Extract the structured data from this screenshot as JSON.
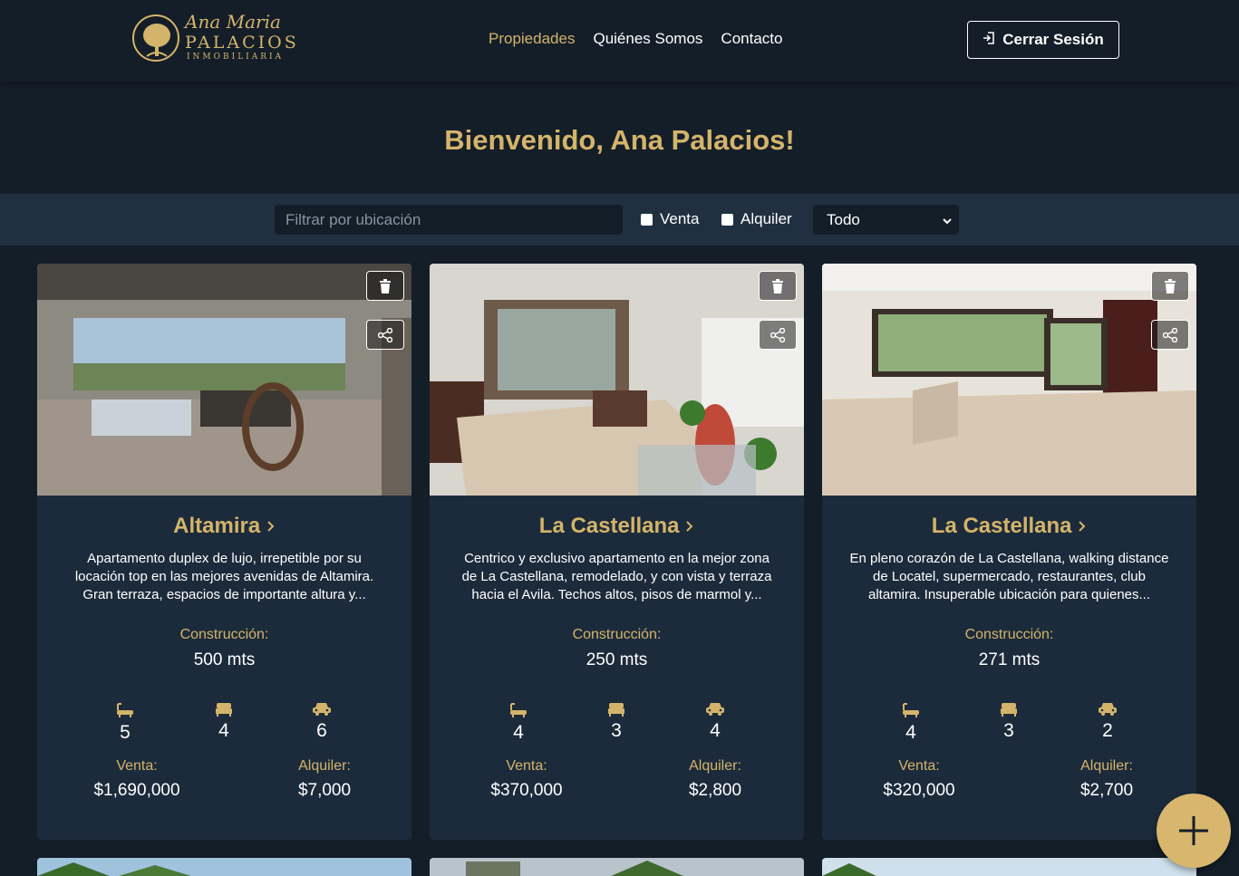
{
  "brand": {
    "script": "Ana Maria",
    "name": "PALACIOS",
    "sub": "INMOBILIARIA",
    "accent": "#d4b46a"
  },
  "nav": {
    "items": [
      {
        "label": "Propiedades",
        "active": true
      },
      {
        "label": "Quiénes Somos",
        "active": false
      },
      {
        "label": "Contacto",
        "active": false
      }
    ],
    "logout_label": "Cerrar Sesión"
  },
  "welcome": "Bienvenido, Ana Palacios!",
  "filters": {
    "location_placeholder": "Filtrar por ubicación",
    "venta_label": "Venta",
    "alquiler_label": "Alquiler",
    "type_selected": "Todo"
  },
  "labels": {
    "construction": "Construcción:",
    "sale": "Venta:",
    "rent": "Alquiler:"
  },
  "properties": [
    {
      "title": "Altamira",
      "description": "Apartamento duplex de lujo, irrepetible por su locación top en las mejores avenidas de Altamira. Gran terraza, espacios de importante altura y...",
      "construction": "500 mts",
      "baths": "5",
      "beds": "4",
      "parking": "6",
      "sale_price": "$1,690,000",
      "rent_price": "$7,000"
    },
    {
      "title": "La Castellana",
      "description": "Centrico y exclusivo apartamento en la mejor zona de La Castellana, remodelado, y con vista y terraza hacia el Avila. Techos altos, pisos de marmol y...",
      "construction": "250 mts",
      "baths": "4",
      "beds": "3",
      "parking": "4",
      "sale_price": "$370,000",
      "rent_price": "$2,800"
    },
    {
      "title": "La Castellana",
      "description": "En pleno corazón de La Castellana, walking distance de Locatel, supermercado, restaurantes, club altamira. Insuperable ubicación para quienes...",
      "construction": "271 mts",
      "baths": "4",
      "beds": "3",
      "parking": "2",
      "sale_price": "$320,000",
      "rent_price": "$2,700"
    }
  ]
}
